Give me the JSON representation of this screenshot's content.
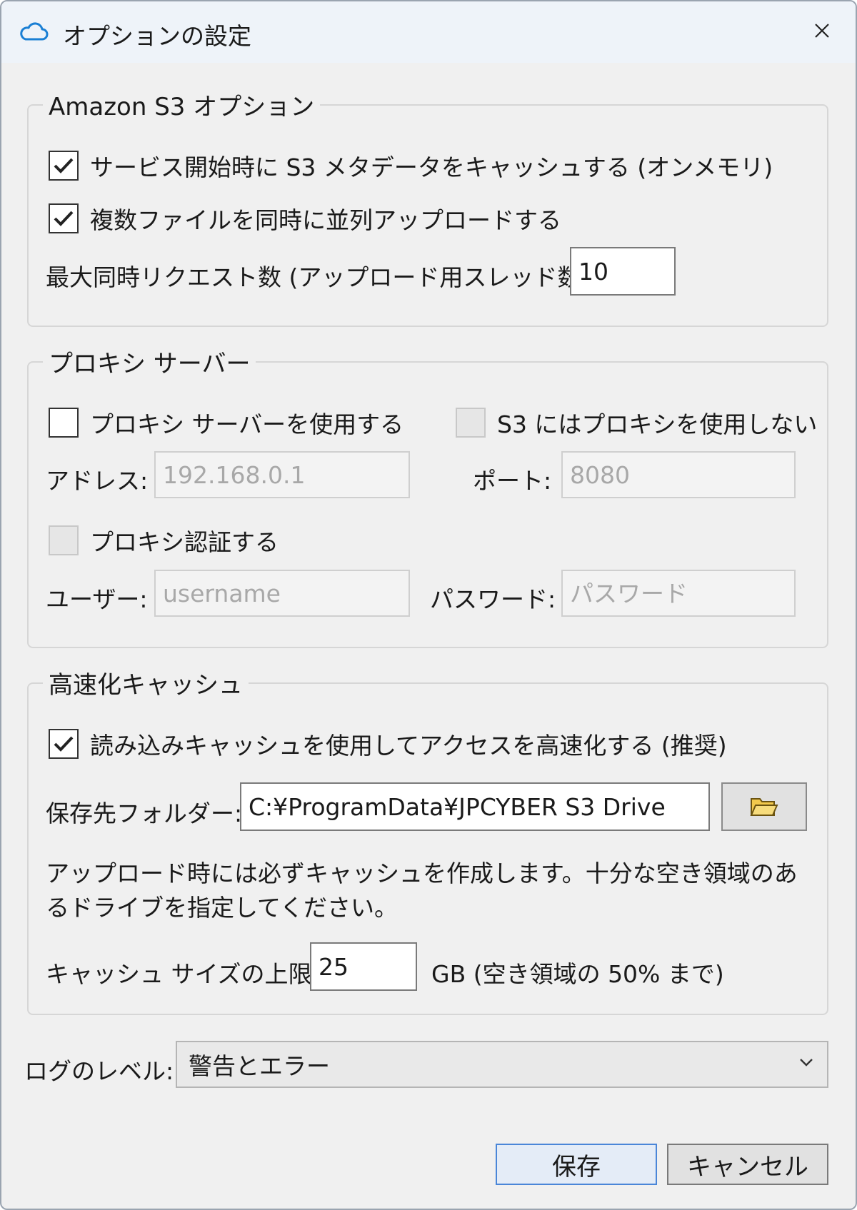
{
  "window": {
    "title": "オプションの設定"
  },
  "s3": {
    "label": "Amazon S3 オプション",
    "cache_metadata": {
      "label": "サービス開始時に S3 メタデータをキャッシュする (オンメモリ)",
      "checked": true
    },
    "parallel_upload": {
      "label": "複数ファイルを同時に並列アップロードする",
      "checked": true
    },
    "max_requests_label": "最大同時リクエスト数 (アップロード用スレッド数) ：",
    "max_requests_value": "10"
  },
  "proxy": {
    "label": "プロキシ サーバー",
    "use_proxy": {
      "label": "プロキシ サーバーを使用する",
      "checked": false
    },
    "no_proxy_s3": {
      "label": "S3 にはプロキシを使用しない",
      "checked": false
    },
    "address_label": "アドレス:",
    "address_placeholder": "192.168.0.1",
    "port_label": "ポート:",
    "port_placeholder": "8080",
    "auth": {
      "label": "プロキシ認証する",
      "checked": false
    },
    "user_label": "ユーザー:",
    "user_placeholder": "username",
    "password_label": "パスワード:",
    "password_placeholder": "パスワード"
  },
  "cache": {
    "label": "高速化キャッシュ",
    "read_cache": {
      "label": "読み込みキャッシュを使用してアクセスを高速化する (推奨)",
      "checked": true
    },
    "folder_label": "保存先フォルダー:",
    "folder_value": "C:¥ProgramData¥JPCYBER S3 Drive",
    "note": "アップロード時には必ずキャッシュを作成します。十分な空き領域のあるドライブを指定してください。",
    "size_label": "キャッシュ サイズの上限:",
    "size_value": "25",
    "size_unit": "GB  (空き領域の 50% まで)"
  },
  "log": {
    "label": "ログのレベル:",
    "value": "警告とエラー"
  },
  "buttons": {
    "save": "保存",
    "cancel": "キャンセル"
  },
  "icons": {
    "app": "cloud-icon",
    "close": "close-icon",
    "check": "check-icon",
    "folder": "folder-icon",
    "dropdown": "chevron-down-icon"
  },
  "colors": {
    "accent": "#1a7fd4",
    "folder": "#f2c94c"
  }
}
